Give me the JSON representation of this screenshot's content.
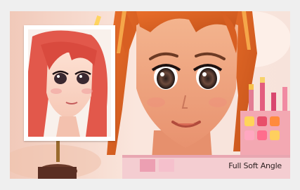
{
  "scene": {
    "caption": "Full Soft Angle"
  },
  "icons": {
    "portrait": "character-face-closeup",
    "mirror": "vanity-mirror",
    "palette": "makeup-palette"
  }
}
